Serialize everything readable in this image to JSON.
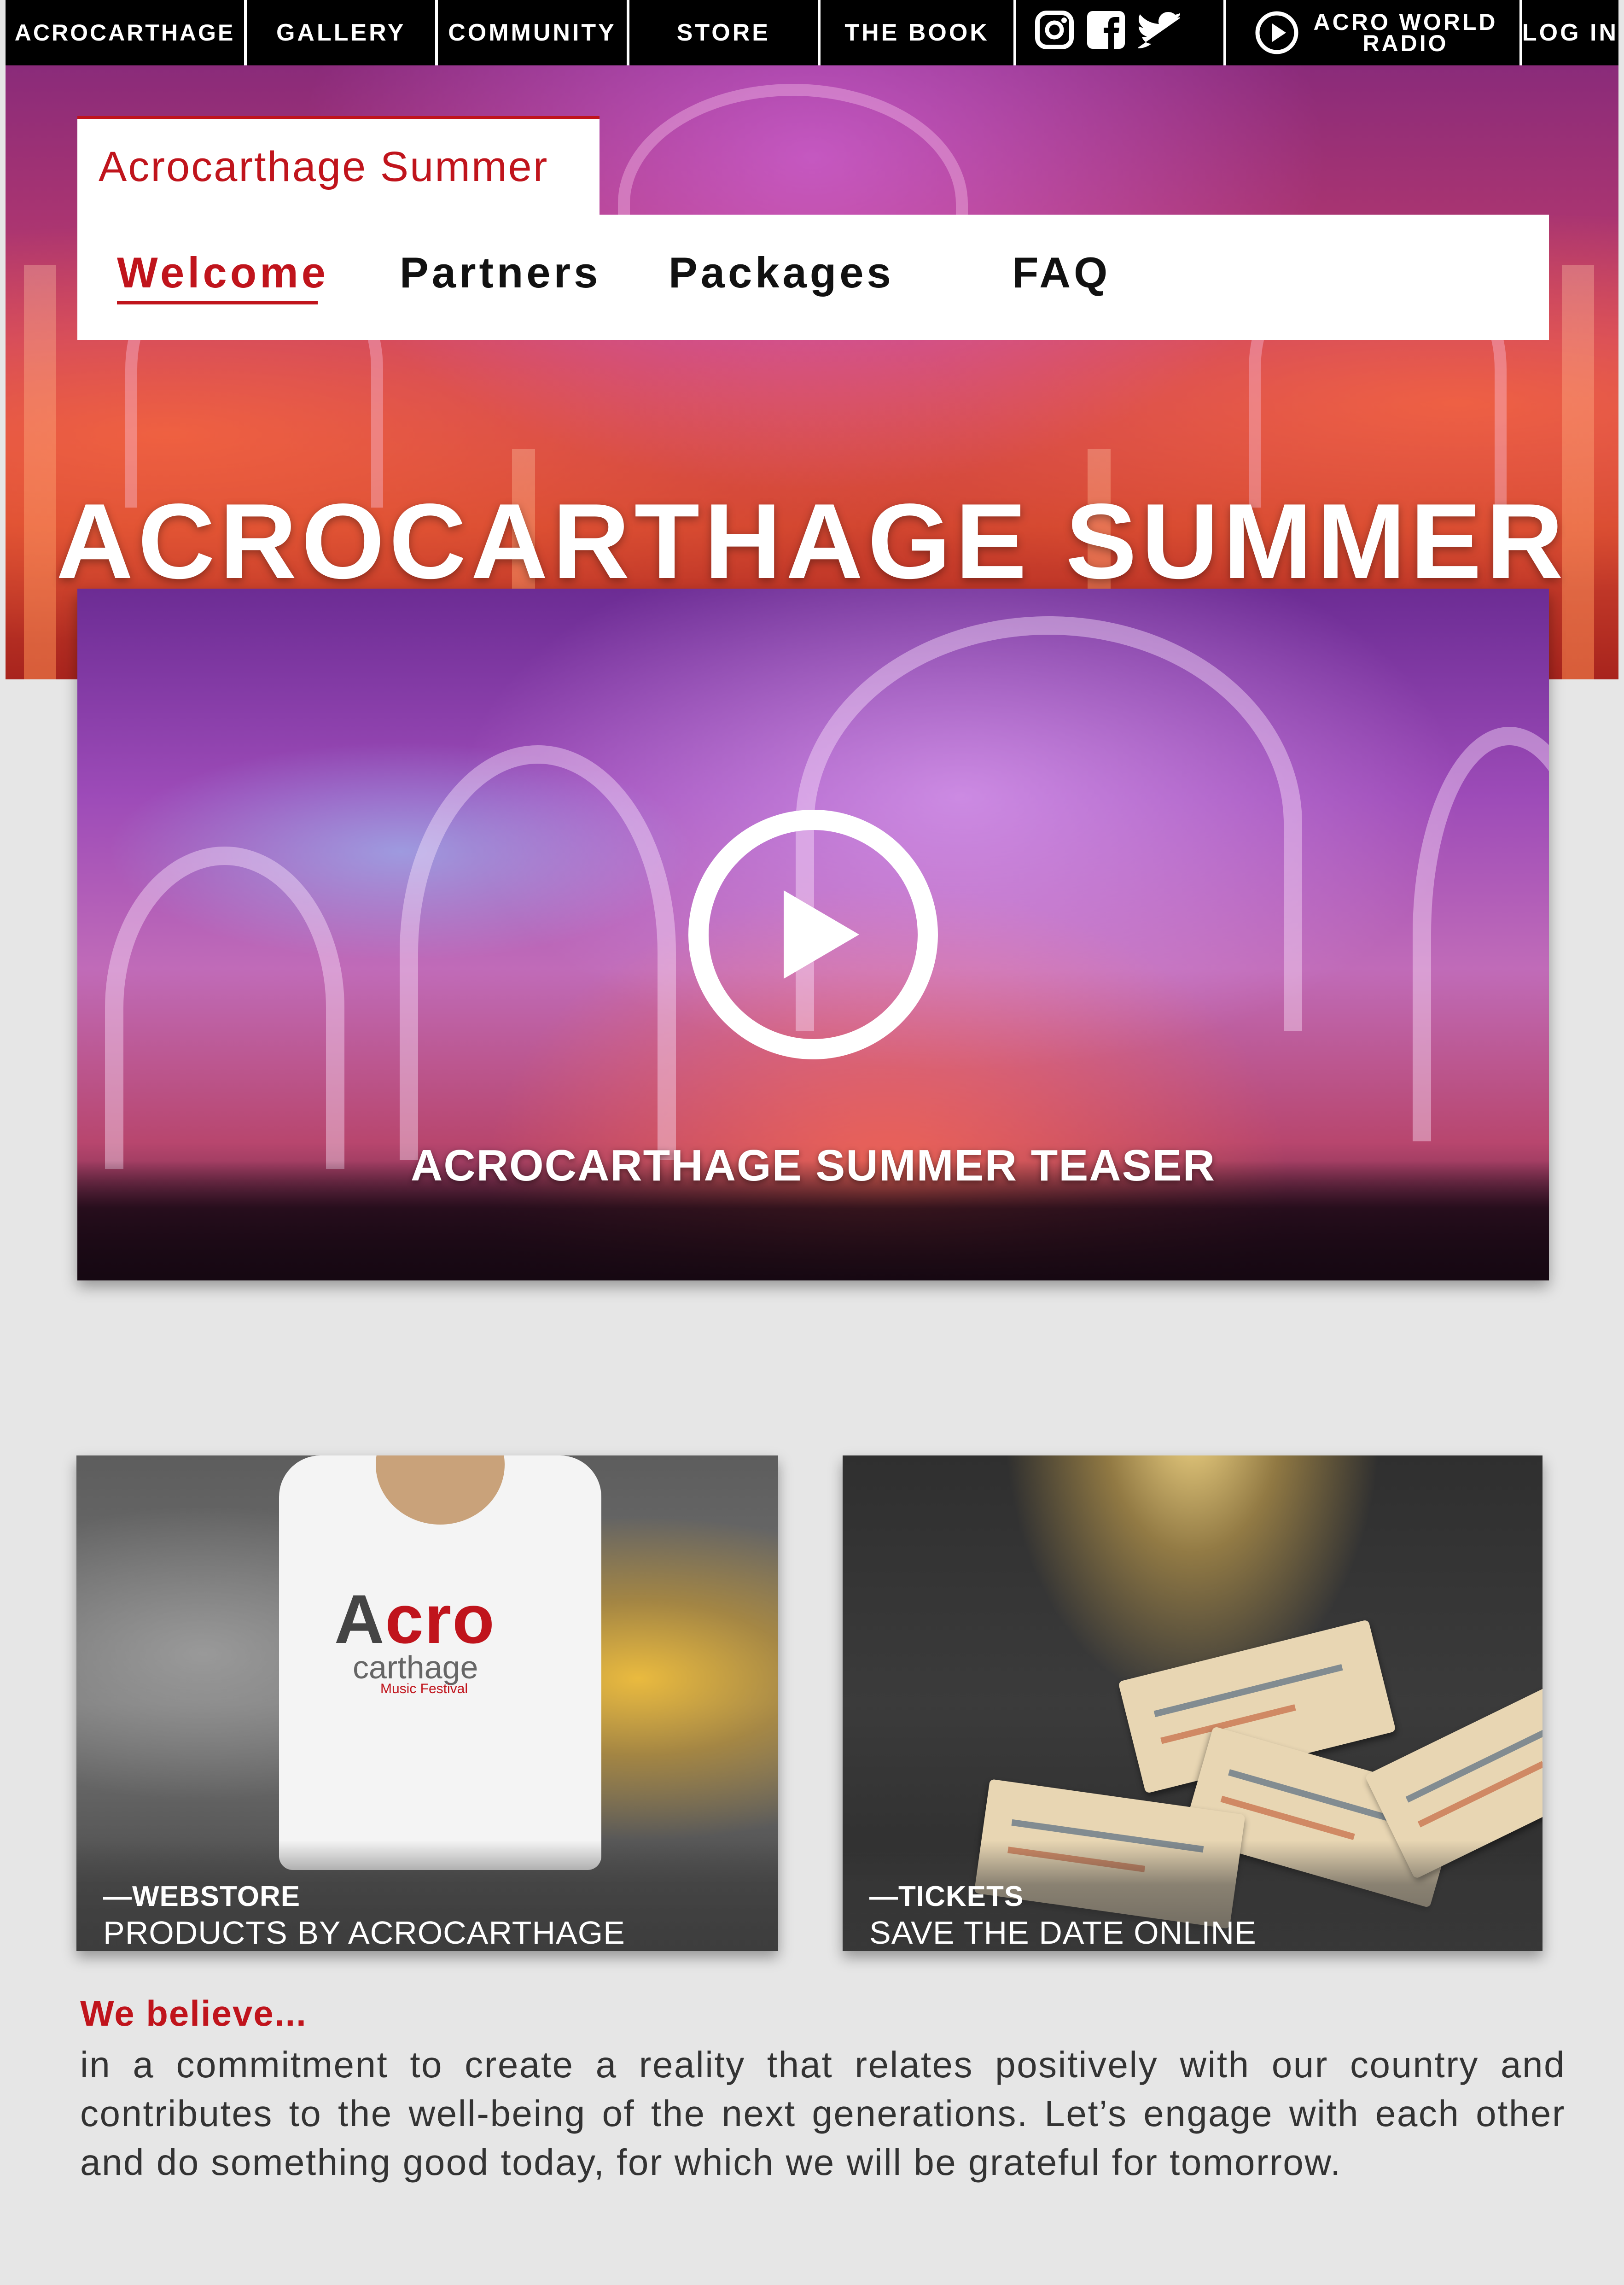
{
  "topnav": {
    "home": "ACROCARTHAGE",
    "gallery": "GALLERY",
    "community": "COMMUNITY",
    "store": "STORE",
    "book": "THE BOOK",
    "social_icons": [
      "instagram-icon",
      "facebook-icon",
      "twitter-icon"
    ],
    "radio_line1": "ACRO WORLD",
    "radio_line2": "RADIO",
    "login": "LOG IN"
  },
  "page": {
    "section_tab": "Acrocarthage Summer",
    "hero_title": "ACROCARTHAGE SUMMER"
  },
  "subnav": {
    "items": [
      "Welcome",
      "Partners",
      "Packages",
      "FAQ"
    ],
    "active": "Welcome"
  },
  "video": {
    "caption": "ACROCARTHAGE SUMMER TEASER"
  },
  "cards": [
    {
      "kicker": "—WEBSTORE",
      "subtitle": "PRODUCTS BY ACROCARTHAGE",
      "shirt_logo": {
        "a": "A",
        "cro": "cro",
        "carthage": "carthage",
        "festival": "Music Festival"
      }
    },
    {
      "kicker": "—TICKETS",
      "subtitle": "SAVE THE DATE ONLINE"
    }
  ],
  "believe": {
    "title": "We believe...",
    "text": "in a commitment to create a reality that relates positively with our country and contributes to the well-being of the next generations. Let’s engage with each other and do something good today, for which we will be grateful for tomorrow."
  },
  "colors": {
    "accent": "#c0141c",
    "nav_bg": "#000000",
    "page_bg": "#e6e6e6"
  }
}
